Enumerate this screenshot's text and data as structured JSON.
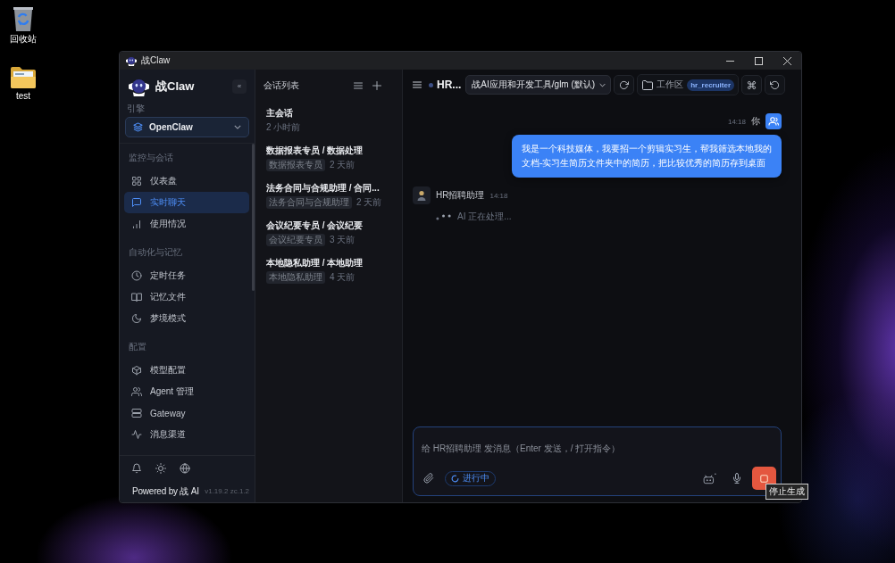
{
  "desktop": {
    "icons": [
      {
        "kind": "recycle-bin",
        "label": "回收站"
      },
      {
        "kind": "folder",
        "label": "test"
      }
    ]
  },
  "window": {
    "title": "战Claw"
  },
  "sidebar": {
    "brand": "战Claw",
    "collapse_button": "«",
    "engine_label": "引擎",
    "engine": "OpenClaw",
    "sections": [
      {
        "title": "监控与会话",
        "items": [
          {
            "kind": "dashboard",
            "label": "仪表盘",
            "selected": false
          },
          {
            "kind": "chat",
            "label": "实时聊天",
            "selected": true
          },
          {
            "kind": "usage",
            "label": "使用情况",
            "selected": false
          }
        ]
      },
      {
        "title": "自动化与记忆",
        "items": [
          {
            "kind": "schedule",
            "label": "定时任务",
            "selected": false
          },
          {
            "kind": "memory",
            "label": "记忆文件",
            "selected": false
          },
          {
            "kind": "dream",
            "label": "梦境模式",
            "selected": false
          }
        ]
      },
      {
        "title": "配置",
        "items": [
          {
            "kind": "model",
            "label": "模型配置",
            "selected": false
          },
          {
            "kind": "agents",
            "label": "Agent 管理",
            "selected": false
          },
          {
            "kind": "gateway",
            "label": "Gateway",
            "selected": false
          },
          {
            "kind": "channels",
            "label": "消息渠道",
            "selected": false
          }
        ]
      }
    ],
    "footer": {
      "powered_by": "Powered by 战 AI",
      "version": "v1.19.2 zc.1.2"
    }
  },
  "conversations": {
    "title": "会话列表",
    "items": [
      {
        "title": "主会话",
        "time": "2 小时前",
        "selected": false
      },
      {
        "title": "数据报表专员 / 数据处理",
        "tag": "数据报表专员",
        "time": "2 天前",
        "selected": false
      },
      {
        "title": "法务合同与合规助理 / 合同...",
        "tag": "法务合同与合规助理",
        "time": "2 天前",
        "selected": false
      },
      {
        "title": "会议纪要专员 / 会议纪要",
        "tag": "会议纪要专员",
        "time": "3 天前",
        "selected": false
      },
      {
        "title": "本地隐私助理 / 本地助理",
        "tag": "本地隐私助理",
        "time": "4 天前",
        "selected": false
      }
    ]
  },
  "chat": {
    "header": {
      "title": "HR...",
      "model": "战AI应用和开发工具/glm (默认)",
      "workspace_label": "工作区",
      "workspace": "hr_recruiter"
    },
    "messages": [
      {
        "kind": "user",
        "time": "14:18",
        "author": "你",
        "text": "我是一个科技媒体，我要招一个剪辑实习生，帮我筛选本地我的文档-实习生简历文件夹中的简历，把比较优秀的简历存到桌面"
      },
      {
        "kind": "assistant",
        "author": "HR招聘助理",
        "time": "14:18",
        "typing": true,
        "status": "AI 正在处理..."
      }
    ],
    "composer": {
      "placeholder": "给 HR招聘助理 发消息（Enter 发送，/ 打开指令）",
      "status": "进行中",
      "stop_tooltip": "停止生成"
    }
  }
}
